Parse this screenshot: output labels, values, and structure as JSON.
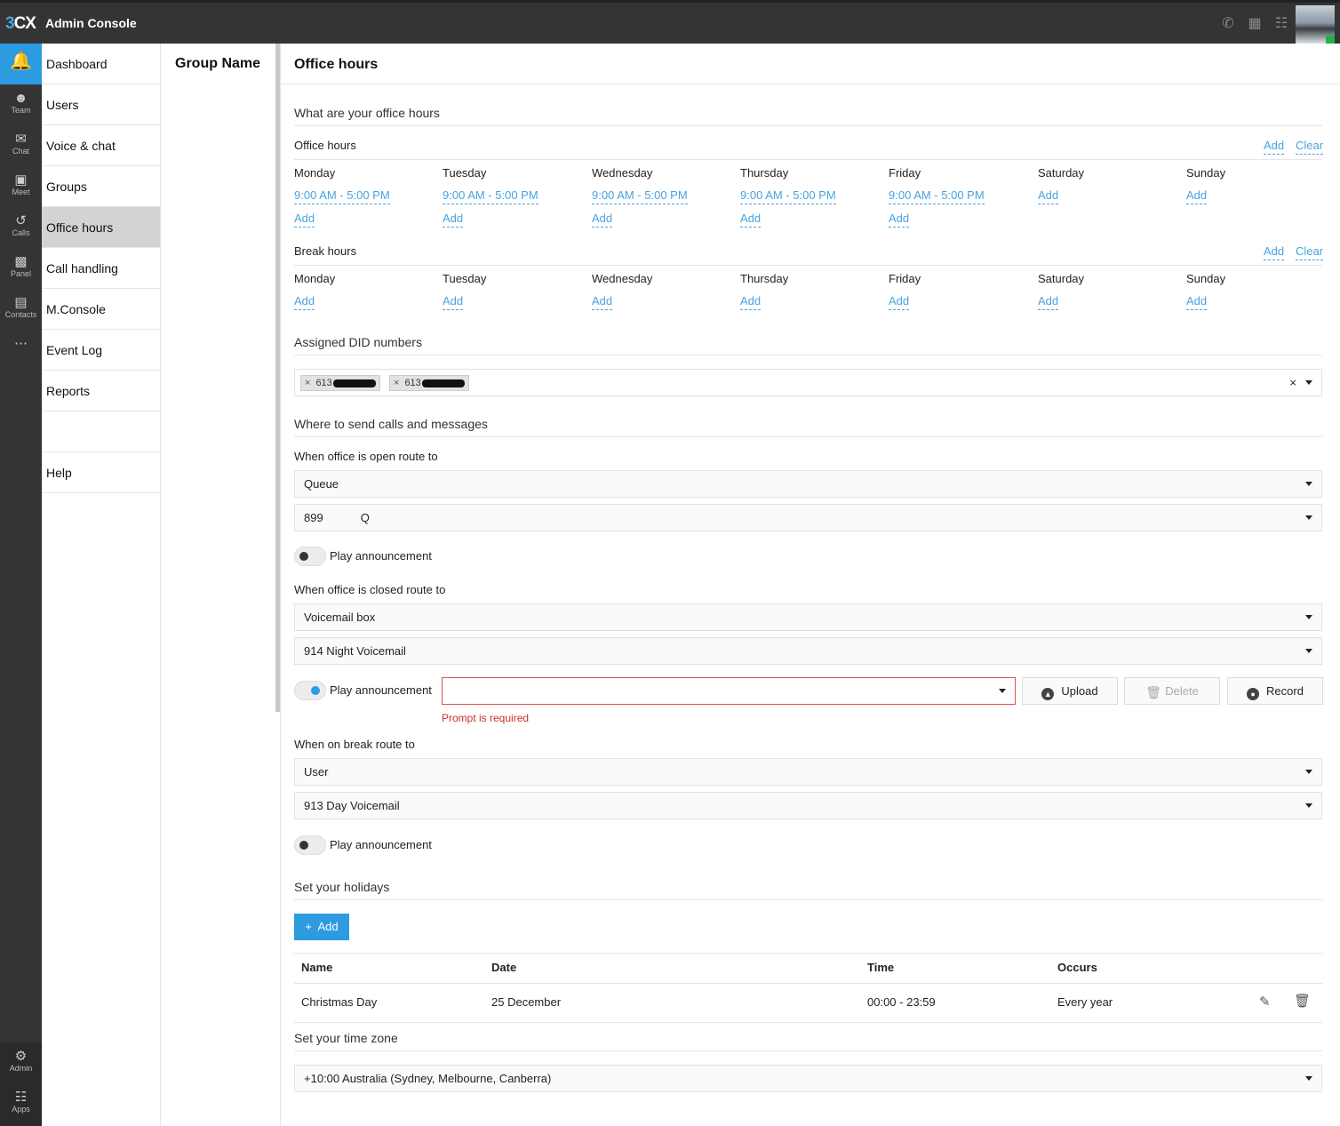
{
  "header": {
    "logo_prefix": "3",
    "logo_suffix": "CX",
    "title": "Admin Console",
    "icons": [
      "phone-icon",
      "qr-code-icon",
      "book-icon"
    ]
  },
  "rail": {
    "items": [
      {
        "name": "notifications",
        "label": "",
        "icon": "bell-icon"
      },
      {
        "name": "team",
        "label": "Team",
        "icon": "team-icon"
      },
      {
        "name": "chat",
        "label": "Chat",
        "icon": "chat-icon"
      },
      {
        "name": "meet",
        "label": "Meet",
        "icon": "meet-icon"
      },
      {
        "name": "calls",
        "label": "Calls",
        "icon": "history-icon"
      },
      {
        "name": "panel",
        "label": "Panel",
        "icon": "bar-chart-icon"
      },
      {
        "name": "contacts",
        "label": "Contacts",
        "icon": "contacts-icon"
      },
      {
        "name": "more",
        "label": "",
        "icon": "more-icon"
      }
    ],
    "bottom": [
      {
        "name": "admin",
        "label": "Admin",
        "icon": "gear-icon"
      },
      {
        "name": "apps",
        "label": "Apps",
        "icon": "apps-icon"
      }
    ]
  },
  "nav": {
    "items": [
      "Dashboard",
      "Users",
      "Voice & chat",
      "Groups",
      "Office hours",
      "Call handling",
      "M.Console",
      "Event Log",
      "Reports"
    ],
    "help": "Help",
    "active": "Office hours"
  },
  "group": {
    "title": "Group Name"
  },
  "main": {
    "title": "Office hours",
    "office_section": "What are your office hours",
    "office_hours_label": "Office hours",
    "break_hours_label": "Break hours",
    "add_label": "Add",
    "clear_label": "Clear",
    "days": [
      "Monday",
      "Tuesday",
      "Wednesday",
      "Thursday",
      "Friday",
      "Saturday",
      "Sunday"
    ],
    "office_hours": [
      "9:00 AM - 5:00 PM",
      "9:00 AM - 5:00 PM",
      "9:00 AM - 5:00 PM",
      "9:00 AM - 5:00 PM",
      "9:00 AM - 5:00 PM",
      "",
      ""
    ],
    "did_section": "Assigned DID numbers",
    "did_tags": [
      "613",
      "613"
    ],
    "did_clear": "×",
    "route_section": "Where to send calls and messages",
    "open_label": "When office is open route to",
    "open_type": "Queue",
    "open_target_num": "899",
    "open_target_name": "Q",
    "play_announcement": "Play announcement",
    "closed_label": "When office is closed route to",
    "closed_type": "Voicemail box",
    "closed_target": "914  Night Voicemail",
    "prompt_error": "Prompt is required",
    "upload": "Upload",
    "delete": "Delete",
    "record": "Record",
    "break_label": "When on break route to",
    "break_type": "User",
    "break_target": "913  Day Voicemail",
    "holidays_section": "Set your holidays",
    "holiday_add": "Add",
    "holiday_columns": [
      "Name",
      "Date",
      "Time",
      "Occurs"
    ],
    "holidays": [
      {
        "name": "Christmas Day",
        "date": "25 December",
        "time": "00:00 - 23:59",
        "occurs": "Every year"
      }
    ],
    "timezone_section": "Set your time zone",
    "timezone": "+10:00 Australia (Sydney, Melbourne, Canberra)"
  },
  "colors": {
    "accent": "#2d9be0",
    "link": "#4aa3df",
    "sidebar": "#343434",
    "error": "#c9302c",
    "online": "#22b14c"
  }
}
